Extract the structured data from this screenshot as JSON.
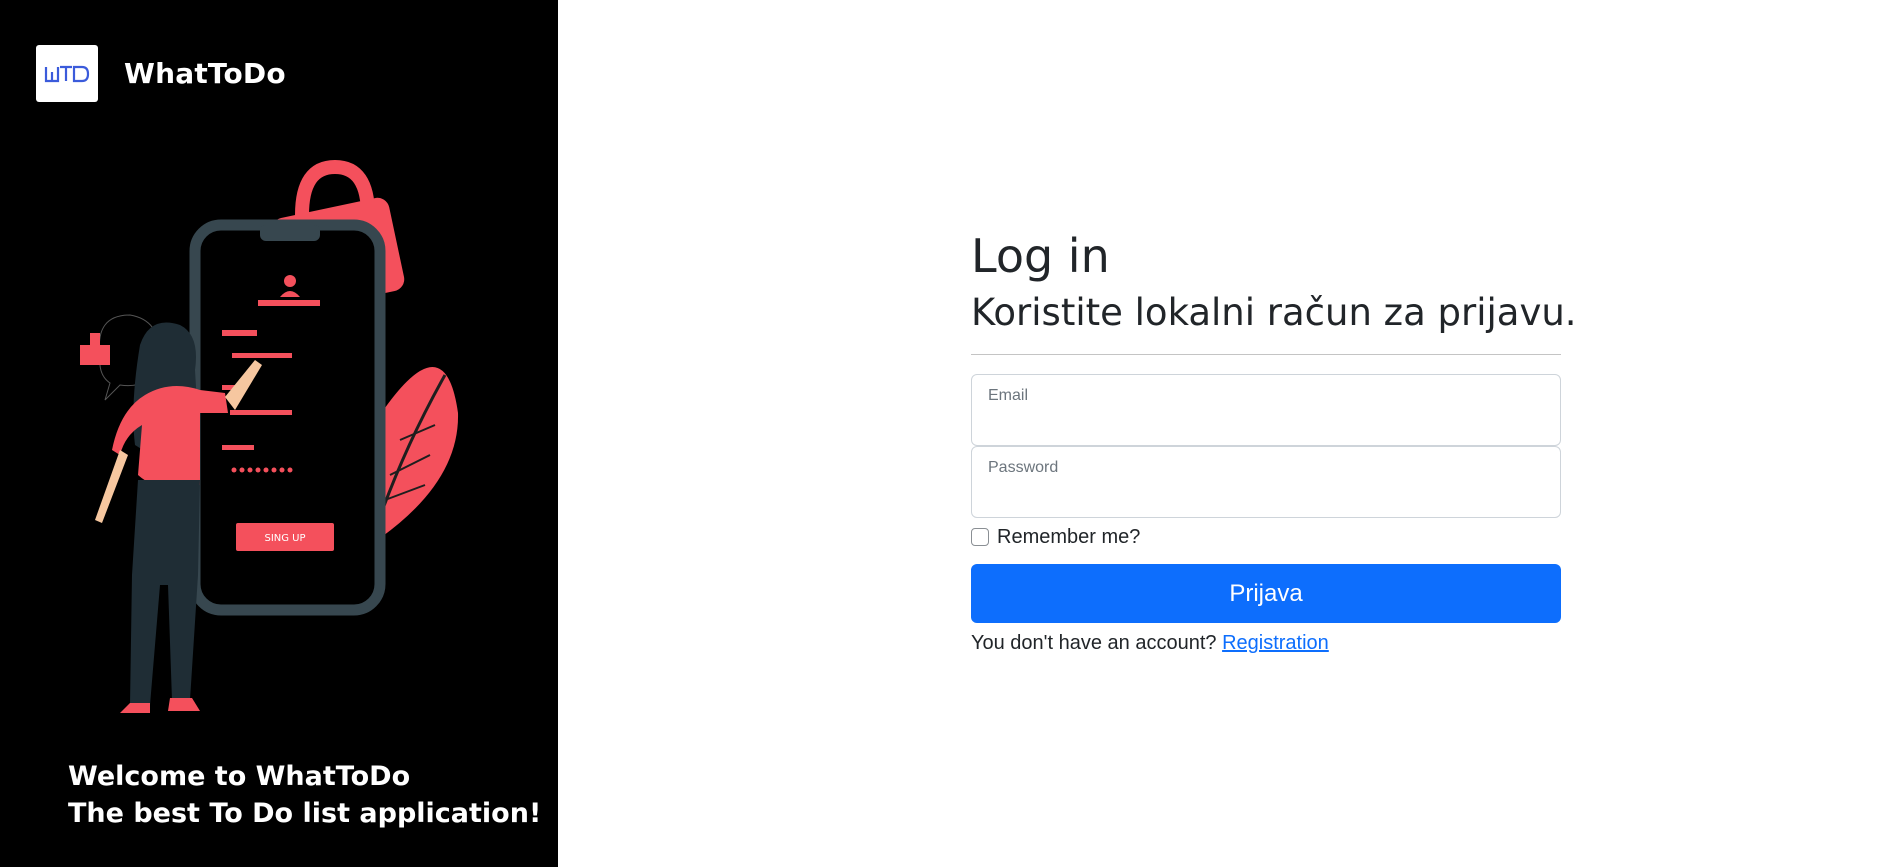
{
  "brand": {
    "logo_text": "WTD",
    "name": "WhatToDo"
  },
  "illustration": {
    "button_label": "SING UP"
  },
  "welcome": {
    "line1": "Welcome to WhatToDo",
    "line2": "The best To Do list application!"
  },
  "form": {
    "title": "Log in",
    "subtitle": "Koristite lokalni račun za prijavu.",
    "email_label": "Email",
    "password_label": "Password",
    "remember_label": "Remember me?",
    "submit_label": "Prijava",
    "register_prompt": "You don't have an account?",
    "register_link": "Registration"
  },
  "colors": {
    "accent": "#0d6efd",
    "panel": "#000000",
    "illustration_red": "#f4505c",
    "illustration_dark": "#37474f"
  }
}
